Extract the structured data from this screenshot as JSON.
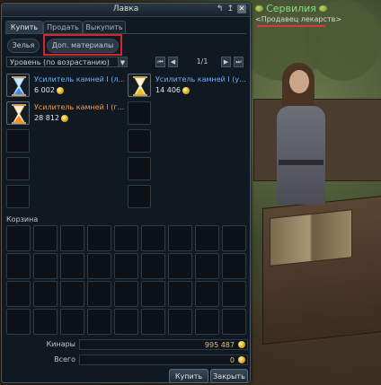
{
  "window": {
    "title": "Лавка",
    "title_icons": [
      "minimize-icon",
      "pin-icon",
      "close-icon"
    ],
    "close_glyph": "✕"
  },
  "tabs": [
    {
      "label": "Купить",
      "active": true
    },
    {
      "label": "Продать",
      "active": false
    },
    {
      "label": "Выкупить",
      "active": false
    }
  ],
  "subtabs": [
    {
      "label": "Зелья",
      "active": false
    },
    {
      "label": "Доп. материалы",
      "active": true
    }
  ],
  "sort": {
    "value": "Уровень (по возрастанию)"
  },
  "pagination": {
    "current": "1/1"
  },
  "items": [
    {
      "name": "Усилитель камней I (л...",
      "price": "6 002",
      "color": "blue",
      "icon": "hourglass-blue-icon"
    },
    {
      "name": "Усилитель камней I (у...",
      "price": "14 406",
      "color": "blue",
      "icon": "hourglass-gold-icon"
    },
    {
      "name": "Усилитель камней I (г...",
      "price": "28 812",
      "color": "orange",
      "icon": "hourglass-orange-icon"
    }
  ],
  "basket": {
    "label": "Корзина"
  },
  "currency": {
    "label": "Кинары",
    "value": "995 487"
  },
  "total": {
    "label": "Всего",
    "value": "0"
  },
  "buttons": {
    "buy": "Купить",
    "close": "Закрыть"
  },
  "npc": {
    "name": "Сервилия",
    "title": "<Продавец лекарств>"
  },
  "colors": {
    "highlight": "#d32828",
    "item_blue": "#6fb0ff",
    "item_orange": "#ff9a3c",
    "npc_name": "#7fe07a"
  }
}
